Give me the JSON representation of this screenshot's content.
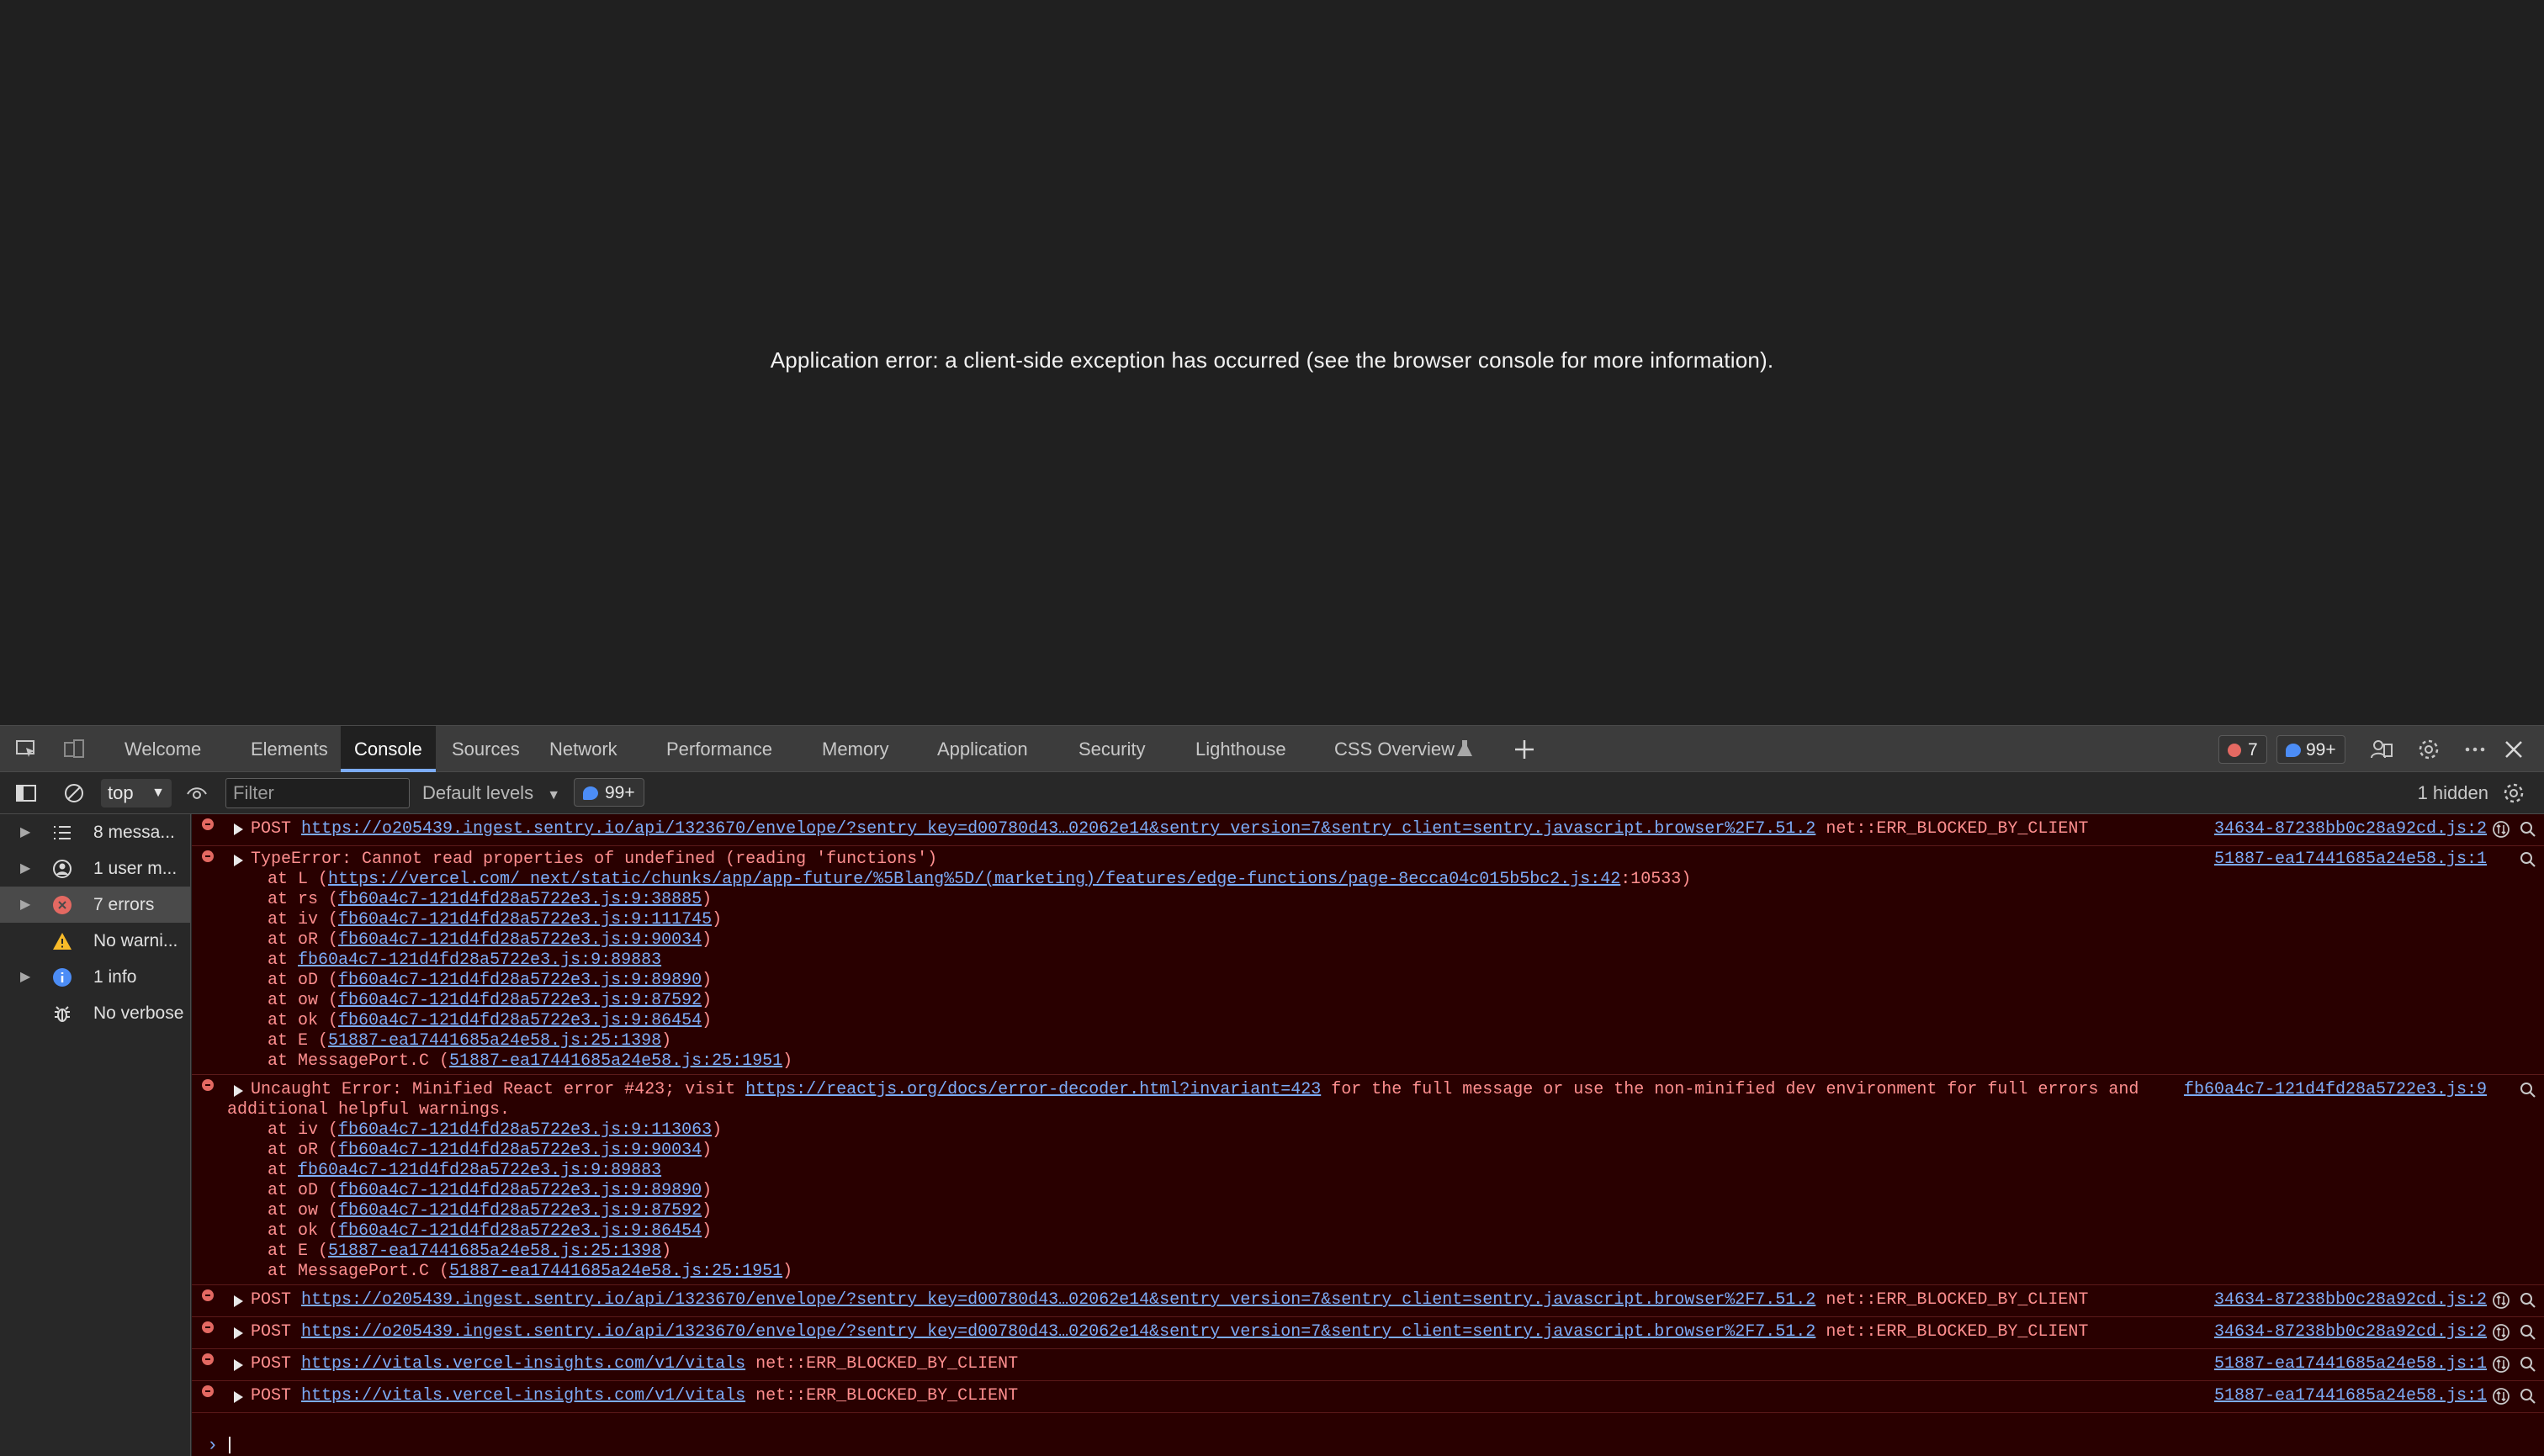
{
  "page": {
    "error_text": "Application error: a client-side exception has occurred (see the browser console for more information)."
  },
  "devtools": {
    "tabs": [
      "Welcome",
      "Elements",
      "Console",
      "Sources",
      "Network",
      "Performance",
      "Memory",
      "Application",
      "Security",
      "Lighthouse",
      "CSS Overview"
    ],
    "active_tab": "Console",
    "error_badge": "7",
    "info_badge": "99+",
    "toolbar": {
      "context": "top",
      "filter_placeholder": "Filter",
      "levels": "Default levels",
      "issues_badge": "99+",
      "hidden": "1 hidden"
    },
    "sidebar": [
      {
        "label": "8 messa...",
        "icon": "list-icon"
      },
      {
        "label": "1 user m...",
        "icon": "user-icon"
      },
      {
        "label": "7 errors",
        "icon": "error-icon"
      },
      {
        "label": "No warni...",
        "icon": "warning-icon"
      },
      {
        "label": "1 info",
        "icon": "info-icon"
      },
      {
        "label": "No verbose",
        "icon": "bug-icon"
      }
    ],
    "colors": {
      "error_bg": "#290000",
      "error_text": "#ff8f8f",
      "link": "#7cacf8",
      "accent": "#7cacf8"
    }
  },
  "console": {
    "m1": {
      "method": "POST ",
      "url": "https://o205439.ingest.sentry.io/api/1323670/envelope/?sentry_key=d00780d43…02062e14&sentry_version=7&sentry_client=sentry.javascript.browser%2F7.51.2",
      "status": " net::ERR_BLOCKED_BY_CLIENT",
      "source": "34634-87238bb0c28a92cd.js:2"
    },
    "m2": {
      "head": "TypeError: Cannot read properties of undefined (reading 'functions')",
      "l1_prefix": "at L (",
      "l1_link": "https://vercel.com/_next/static/chunks/app/app-future/%5Blang%5D/(marketing",
      "l1_link2": ")/features/edge-functions/page-8ecca04c015b5bc2.js:42",
      "l1_suffix": ":10533)",
      "l2_prefix": "at rs (",
      "l2_link": "fb60a4c7-121d4fd28a5722e3.js:9:38885",
      "l3_prefix": "at iv (",
      "l3_link": "fb60a4c7-121d4fd28a5722e3.js:9:111745",
      "l4_prefix": "at oR (",
      "l4_link": "fb60a4c7-121d4fd28a5722e3.js:9:90034",
      "l5_prefix": "at ",
      "l5_link": "fb60a4c7-121d4fd28a5722e3.js:9:89883",
      "l6_prefix": "at oD (",
      "l6_link": "fb60a4c7-121d4fd28a5722e3.js:9:89890",
      "l7_prefix": "at ow (",
      "l7_link": "fb60a4c7-121d4fd28a5722e3.js:9:87592",
      "l8_prefix": "at ok (",
      "l8_link": "fb60a4c7-121d4fd28a5722e3.js:9:86454",
      "l9_prefix": "at E (",
      "l9_link": "51887-ea17441685a24e58.js:25:1398",
      "l10_prefix": "at MessagePort.C (",
      "l10_link": "51887-ea17441685a24e58.js:25:1951",
      "close": ")",
      "source": "51887-ea17441685a24e58.js:1"
    },
    "m3": {
      "head_prefix": "Uncaught Error: Minified React error #423; visit ",
      "head_link": "https://reactjs.org/docs/error-decoder.html?invariant=423",
      "head_suffix": " for the full message or use the non-minified dev environment for full errors and",
      "head_wrap": "additional helpful warnings.",
      "l1_prefix": "at iv (",
      "l1_link": "fb60a4c7-121d4fd28a5722e3.js:9:113063",
      "l2_prefix": "at oR (",
      "l2_link": "fb60a4c7-121d4fd28a5722e3.js:9:90034",
      "l3_prefix": "at ",
      "l3_link": "fb60a4c7-121d4fd28a5722e3.js:9:89883",
      "l4_prefix": "at oD (",
      "l4_link": "fb60a4c7-121d4fd28a5722e3.js:9:89890",
      "l5_prefix": "at ow (",
      "l5_link": "fb60a4c7-121d4fd28a5722e3.js:9:87592",
      "l6_prefix": "at ok (",
      "l6_link": "fb60a4c7-121d4fd28a5722e3.js:9:86454",
      "l7_prefix": "at E (",
      "l7_link": "51887-ea17441685a24e58.js:25:1398",
      "l8_prefix": "at MessagePort.C (",
      "l8_link": "51887-ea17441685a24e58.js:25:1951",
      "close": ")",
      "source": "fb60a4c7-121d4fd28a5722e3.js:9"
    },
    "m4": {
      "method": "POST ",
      "url": "https://o205439.ingest.sentry.io/api/1323670/envelope/?sentry_key=d00780d43…02062e14&sentry_version=7&sentry_client=sentry.javascript.browser%2F7.51.2",
      "status": " net::ERR_BLOCKED_BY_CLIENT",
      "source": "34634-87238bb0c28a92cd.js:2"
    },
    "m5": {
      "method": "POST ",
      "url": "https://o205439.ingest.sentry.io/api/1323670/envelope/?sentry_key=d00780d43…02062e14&sentry_version=7&sentry_client=sentry.javascript.browser%2F7.51.2",
      "status": " net::ERR_BLOCKED_BY_CLIENT",
      "source": "34634-87238bb0c28a92cd.js:2"
    },
    "m6": {
      "method": "POST ",
      "url": "https://vitals.vercel-insights.com/v1/vitals",
      "status": " net::ERR_BLOCKED_BY_CLIENT",
      "source": "51887-ea17441685a24e58.js:1"
    },
    "m7": {
      "method": "POST ",
      "url": "https://vitals.vercel-insights.com/v1/vitals",
      "status": " net::ERR_BLOCKED_BY_CLIENT",
      "source": "51887-ea17441685a24e58.js:1"
    },
    "prompt": "›"
  }
}
